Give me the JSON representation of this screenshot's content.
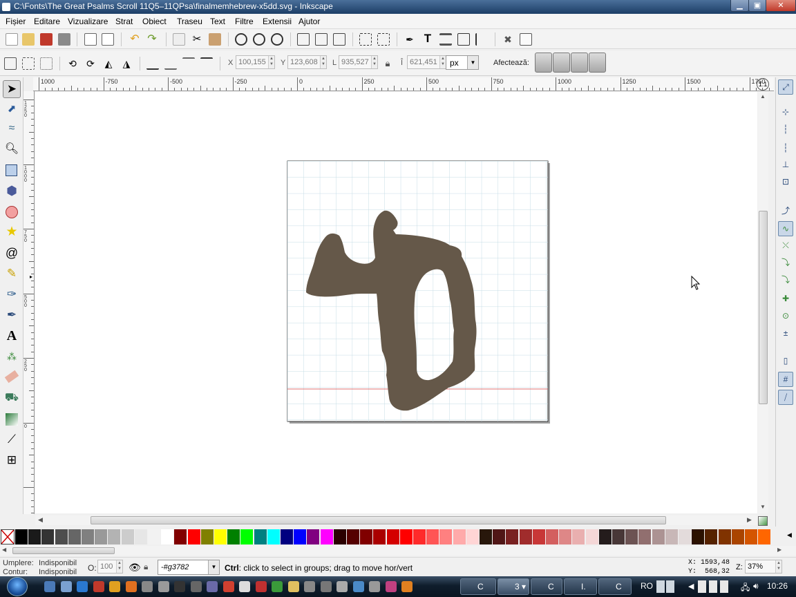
{
  "window": {
    "title": "C:\\Fonts\\The Great Psalms Scroll 11Q5–11QPsa\\finalmemhebrew-x5dd.svg - Inkscape",
    "controls": [
      "minimize",
      "maximize",
      "close"
    ]
  },
  "menubar": {
    "items": [
      "Fișier",
      "Editare",
      "Vizualizare",
      "Strat",
      "Obiect",
      "Traseu",
      "Text",
      "Filtre",
      "Extensii",
      "Ajutor"
    ]
  },
  "commands_bar": {
    "icons": [
      "new-document-icon",
      "open-icon",
      "save-icon",
      "print-icon",
      "import-icon",
      "export-icon",
      "undo-icon",
      "redo-icon",
      "duplicate-icon",
      "cut-icon",
      "paste-icon",
      "zoom-selection-icon",
      "zoom-drawing-icon",
      "zoom-page-icon",
      "duplicate-object-icon",
      "clone-icon",
      "unlink-clone-icon",
      "group-icon",
      "ungroup-icon",
      "fill-stroke-icon",
      "text-font-icon",
      "layers-icon",
      "xml-editor-icon",
      "align-distribute-icon",
      "preferences-icon",
      "document-properties-icon"
    ]
  },
  "selector_bar": {
    "x_label": "X",
    "x_value": "100,155",
    "y_label": "Y",
    "y_value": "123,608",
    "w_label": "L",
    "w_value": "935,527",
    "h_label": "Î",
    "h_value": "621,451",
    "unit": "px",
    "affect_label": "Afectează:",
    "affect_buttons": [
      "scale-stroke-icon",
      "scale-radii-icon",
      "move-gradients-icon",
      "move-patterns-icon"
    ]
  },
  "rulers": {
    "horizontal_labels": [
      "1000",
      "-750",
      "-500",
      "-250",
      "0",
      "250",
      "500",
      "750",
      "1000",
      "1250",
      "1500",
      "1750"
    ],
    "vertical_labels": [
      "1250",
      "1000",
      "750",
      "500",
      "250",
      "0"
    ]
  },
  "toolbox": {
    "tools": [
      "selector-tool-icon",
      "node-tool-icon",
      "tweak-tool-icon",
      "zoom-tool-icon",
      "rectangle-tool-icon",
      "3d-box-tool-icon",
      "ellipse-tool-icon",
      "star-tool-icon",
      "spiral-tool-icon",
      "pencil-tool-icon",
      "pen-tool-icon",
      "calligraphy-tool-icon",
      "text-tool-icon",
      "spray-tool-icon",
      "eraser-tool-icon",
      "paint-bucket-tool-icon",
      "gradient-tool-icon",
      "dropper-tool-icon",
      "connector-tool-icon"
    ],
    "active": "selector-tool-icon"
  },
  "snap_bar": {
    "icons": [
      "snap-enable-icon",
      "snap-bbox-icon",
      "snap-bbox-edge-icon",
      "snap-bbox-corner-icon",
      "snap-bbox-midpoint-icon",
      "snap-bbox-center-icon",
      "snap-nodes-icon",
      "snap-path-icon",
      "snap-intersection-icon",
      "snap-cusp-node-icon",
      "snap-smooth-node-icon",
      "snap-line-midpoint-icon",
      "snap-object-center-icon",
      "snap-rotation-center-icon",
      "snap-page-border-icon",
      "snap-grid-icon",
      "snap-guide-icon"
    ]
  },
  "canvas": {
    "page_color": "#ffffff",
    "grid_color": "#c4dce6",
    "baseline_color": "#e07070",
    "glyph_color": "#655849",
    "cursor": "mouse-pointer-icon"
  },
  "palette": {
    "none_swatch": "none-color-swatch",
    "colors": [
      "#000000",
      "#1a1a1a",
      "#333333",
      "#4d4d4d",
      "#666666",
      "#808080",
      "#999999",
      "#b3b3b3",
      "#cccccc",
      "#e6e6e6",
      "#f2f2f2",
      "#ffffff",
      "#800000",
      "#ff0000",
      "#808000",
      "#ffff00",
      "#008000",
      "#00ff00",
      "#008080",
      "#00ffff",
      "#000080",
      "#0000ff",
      "#800080",
      "#ff00ff",
      "#2b0000",
      "#550000",
      "#800000",
      "#aa0000",
      "#d40000",
      "#ff0000",
      "#ff2a2a",
      "#ff5555",
      "#ff8080",
      "#ffaaaa",
      "#ffd5d5",
      "#28170b",
      "#501616",
      "#782121",
      "#a02c2c",
      "#c83737",
      "#d35f5f",
      "#de8787",
      "#e9afaf",
      "#f4d7d7",
      "#241c1c",
      "#483737",
      "#6c5353",
      "#916f6f",
      "#ac9393",
      "#c8b7b7",
      "#e3dbdb",
      "#2b1100",
      "#552200",
      "#803300",
      "#aa4400",
      "#d45500",
      "#ff6600"
    ]
  },
  "statusbar": {
    "fill_label": "Umplere:",
    "fill_value": "Indisponibil",
    "stroke_label": "Contur:",
    "stroke_value": "Indisponibil",
    "opacity_label": "O:",
    "opacity_value": "100",
    "layer_value": "-#g3782",
    "message_bold": "Ctrl",
    "message_text": ": click to select in groups; drag to move hor/vert",
    "cursor_x": "X: 1593,48",
    "cursor_y": "Y:  568,32",
    "zoom_label": "Z:",
    "zoom_value": "37%"
  },
  "taskbar": {
    "start": "windows-start-orb-icon",
    "quicklaunch": [
      "show-desktop-icon",
      "switch-windows-icon",
      "internet-explorer-icon",
      "save-icon",
      "media-icon",
      "firefox-icon",
      "tools-icon",
      "settings-icon",
      "cmd-icon",
      "calculator-icon",
      "php-icon",
      "chrome-icon",
      "app-icon",
      "opera-icon",
      "messenger-icon",
      "folder-icon",
      "app-icon",
      "app-icon",
      "network-icon",
      "app-icon",
      "app-icon",
      "app-icon",
      "vlc-icon"
    ],
    "tasks": [
      "C",
      "3",
      "C",
      "I.",
      "C"
    ],
    "language": "RO",
    "clock": "10:26"
  }
}
